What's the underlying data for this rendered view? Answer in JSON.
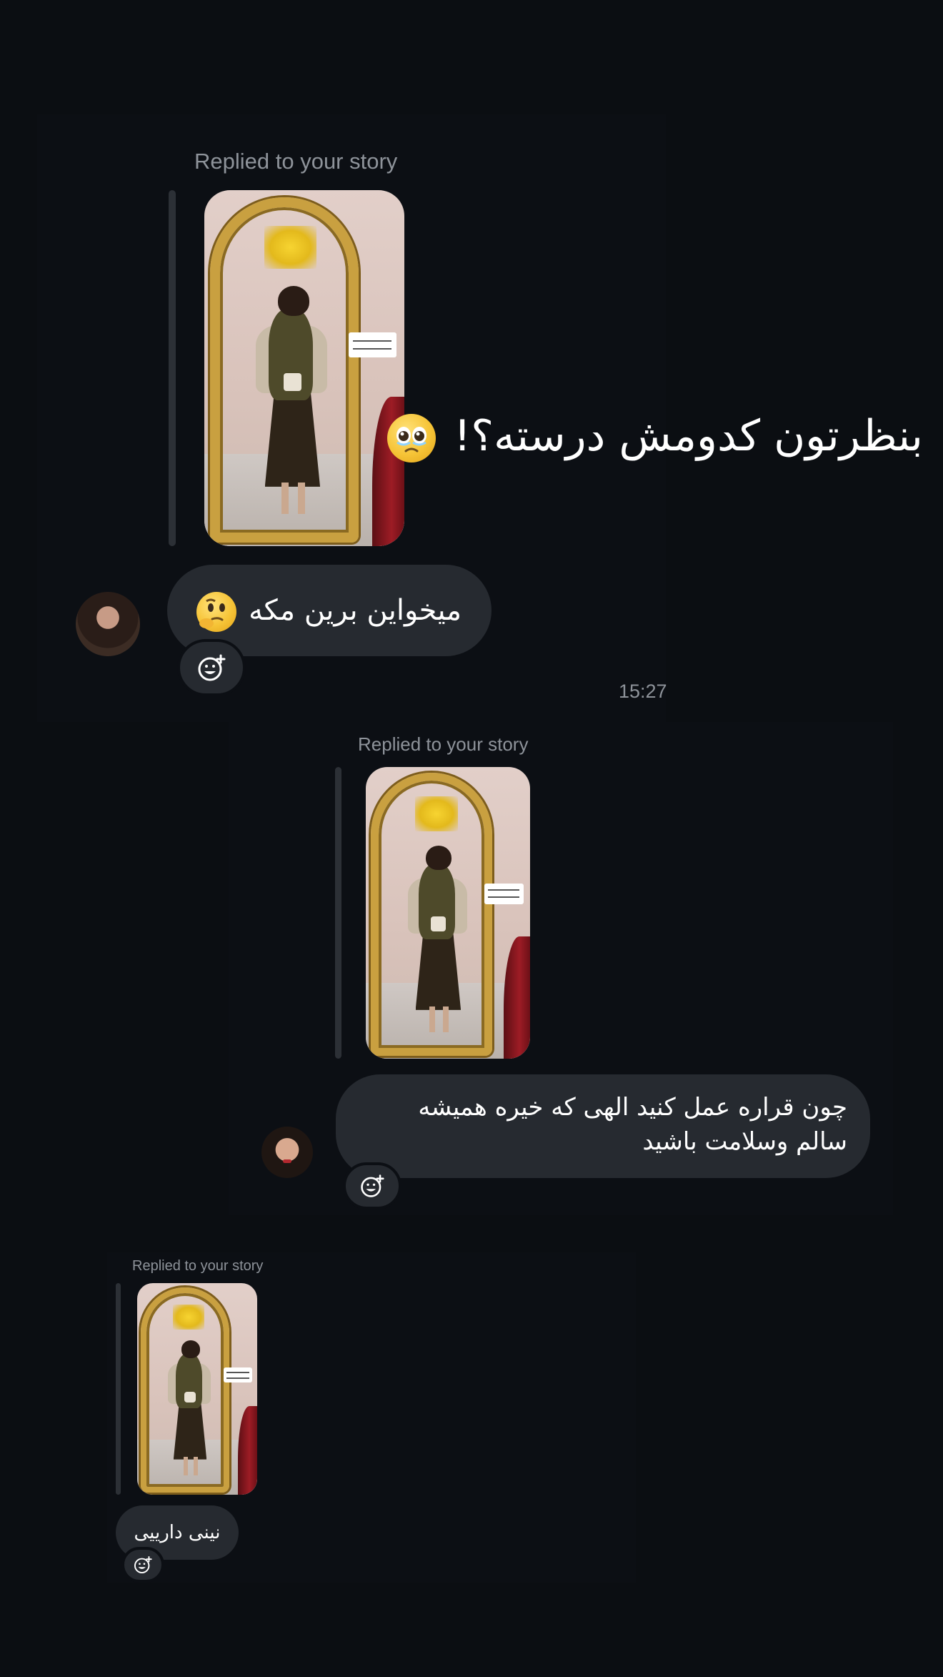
{
  "replied_label": "Replied to your story",
  "time": "15:27",
  "message1": {
    "story_caption": "بنظرتون کدومش درسته؟!",
    "story_caption_emoji": "pleading-face-emoji",
    "reply": "میخواین برین مکه",
    "reply_emoji": "thinking-face-emoji"
  },
  "message2": {
    "reply": "چون قراره عمل کنید الهی که خیره همیشه سالم وسلامت باشید"
  },
  "message3": {
    "reply": "نینی دارییی"
  },
  "icons": {
    "react": "add-reaction-icon"
  },
  "colors": {
    "background": "#0b0e12",
    "bubble": "#262a30",
    "meta_text": "#8e939a"
  }
}
